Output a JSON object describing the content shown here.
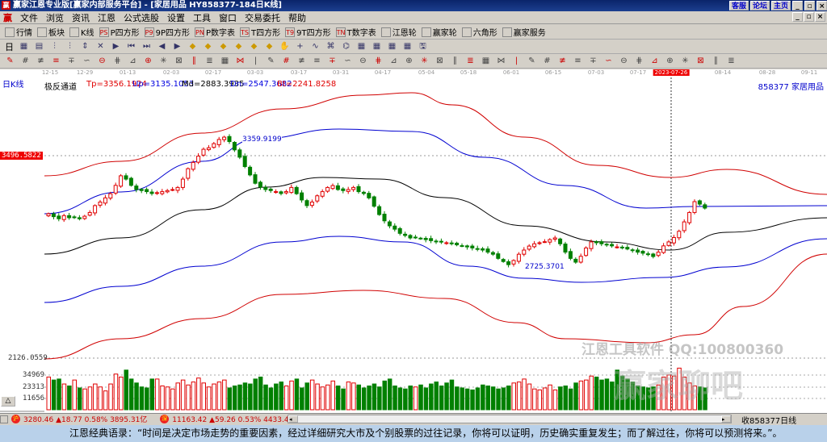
{
  "window": {
    "title": "赢家江恩专业版[赢家内部服务平台] - [家居用品   HY858377-184日K线]",
    "links": [
      "客服",
      "论坛",
      "主页"
    ],
    "controls": [
      "_",
      "▫",
      "×"
    ]
  },
  "menu": [
    "文件",
    "浏览",
    "资讯",
    "江恩",
    "公式选股",
    "设置",
    "工具",
    "窗口",
    "交易委托",
    "帮助"
  ],
  "toolbar1": [
    {
      "icon": "quote-grid-icon",
      "label": "行情"
    },
    {
      "icon": "blocks-icon",
      "label": "板块"
    },
    {
      "icon": "kline-icon",
      "label": "K线"
    },
    {
      "icon": "PS",
      "label": "P四方形"
    },
    {
      "icon": "P9",
      "label": "9P四方形"
    },
    {
      "icon": "PN",
      "label": "P数字表"
    },
    {
      "icon": "TS",
      "label": "T四方形"
    },
    {
      "icon": "T9",
      "label": "9T四方形"
    },
    {
      "icon": "TN",
      "label": "T数字表"
    },
    {
      "icon": "gann-wheel-icon",
      "label": "江恩轮"
    },
    {
      "icon": "winner-wheel-icon",
      "label": "赢家轮"
    },
    {
      "icon": "hexagon-icon",
      "label": "六角形"
    },
    {
      "icon": "dollar-icon",
      "label": "赢家服务"
    }
  ],
  "toolbar2": {
    "period": "日"
  },
  "chart": {
    "period_label": "日K线",
    "indicator_name": "极反通道",
    "indicators": [
      {
        "text": "Tp=3356.1924",
        "color": "#e00000"
      },
      {
        "text": "Up=3135.1053",
        "color": "#0000e0"
      },
      {
        "text": "Md=2883.3935",
        "color": "#000000"
      },
      {
        "text": "Dn=2547.3682",
        "color": "#0000e0"
      },
      {
        "text": "Bt=2241.8258",
        "color": "#e00000"
      }
    ],
    "code_name": "858377  家居用品",
    "dates": [
      "12-15",
      "12-29",
      "01-13",
      "02-03",
      "02-17",
      "03-03",
      "03-17",
      "03-31",
      "04-17",
      "05-04",
      "05-18",
      "06-01",
      "06-15",
      "07-03",
      "07-17",
      "2023-07-26",
      "08-14",
      "08-28",
      "09-11"
    ],
    "price_axis": [
      "3496.5822",
      "2126.0559"
    ],
    "volume_axis": [
      "34969",
      "23313",
      "11656"
    ],
    "high_label": "3359.9199",
    "low_label": "2725.3701",
    "closes": [
      2984,
      2970,
      2960,
      2975,
      2965,
      2968,
      2960,
      2972,
      2990,
      3023,
      3040,
      3060,
      3080,
      3120,
      3166,
      3150,
      3120,
      3100,
      3095,
      3090,
      3081,
      3085,
      3090,
      3095,
      3100,
      3110,
      3150,
      3200,
      3230,
      3260,
      3293,
      3300,
      3320,
      3340,
      3351,
      3330,
      3290,
      3255,
      3210,
      3170,
      3130,
      3112,
      3100,
      3095,
      3090,
      3081,
      3090,
      3110,
      3080,
      3050,
      3023,
      3040,
      3070,
      3090,
      3110,
      3119,
      3100,
      3095,
      3100,
      3110,
      3090,
      3081,
      3060,
      3020,
      2980,
      2950,
      2926,
      2910,
      2890,
      2880,
      2868,
      2870,
      2865,
      2860,
      2855,
      2850,
      2849,
      2845,
      2840,
      2835,
      2830,
      2825,
      2820,
      2815,
      2810,
      2800,
      2790,
      2770,
      2755,
      2740,
      2760,
      2790,
      2810,
      2829,
      2840,
      2845,
      2850,
      2860,
      2868,
      2840,
      2800,
      2770,
      2752,
      2780,
      2820,
      2849,
      2845,
      2840,
      2835,
      2830,
      2825,
      2820,
      2815,
      2810,
      2800,
      2795,
      2790,
      2779,
      2800,
      2830,
      2849,
      2870,
      2900,
      2945,
      2990,
      3042,
      3030,
      3011
    ],
    "volumes": [
      33,
      30,
      31,
      26,
      24,
      30,
      22,
      21,
      23,
      26,
      23,
      19,
      26,
      36,
      33,
      40,
      31,
      27,
      23,
      22,
      31,
      31,
      24,
      23,
      21,
      27,
      30,
      25,
      28,
      32,
      27,
      23,
      26,
      28,
      30,
      22,
      24,
      25,
      27,
      26,
      31,
      33,
      25,
      22,
      26,
      28,
      24,
      29,
      31,
      22,
      27,
      30,
      26,
      23,
      25,
      29,
      24,
      21,
      28,
      27,
      25,
      22,
      24,
      26,
      23,
      29,
      31,
      24,
      22,
      21,
      24,
      23,
      25,
      22,
      26,
      28,
      24,
      27,
      30,
      23,
      22,
      21,
      20,
      22,
      25,
      24,
      23,
      21,
      22,
      24,
      27,
      28,
      31,
      26,
      21,
      20,
      22,
      25,
      20,
      23,
      24,
      21,
      27,
      29,
      30,
      34,
      33,
      30,
      31,
      28,
      40,
      34,
      31,
      28,
      24,
      23,
      22,
      23,
      25,
      33,
      35,
      34,
      42,
      33,
      27,
      24,
      23,
      22,
      24,
      21,
      25,
      24,
      23,
      22,
      30,
      26,
      34,
      35,
      29,
      24,
      23
    ],
    "watermark_1": "江恩工具软件  QQ:100800360",
    "watermark_2": "赢家聊吧"
  },
  "status": {
    "sh": "3280.46 ▲18.77 0.58% 3895.31亿",
    "sz": "11163.42 ▲59.26 0.53% 4433.45亿",
    "sh_icon": "沪",
    "sz_icon": "深",
    "collect": "收858377日线"
  },
  "quote": "江恩经典语录：“时间是决定市场走势的重要因素，经过详细研究大市及个别股票的过往记录，你将可以证明，历史确实重复发生；而了解过往，你将可以预测将来。”。",
  "colors": {
    "up": "#e00000",
    "down": "#008000",
    "titlebar": "#0a246a",
    "quotebar": "#b9d1ea"
  }
}
